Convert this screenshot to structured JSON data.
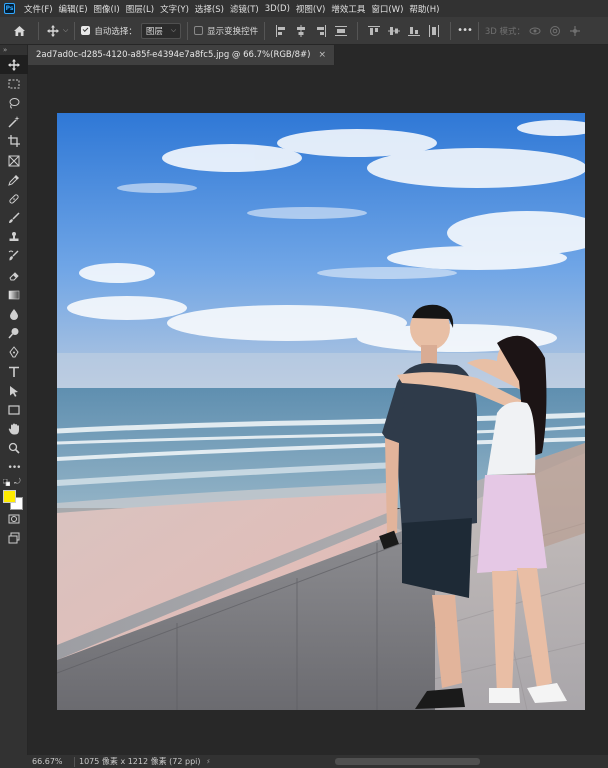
{
  "app": {
    "logo_text": "Ps",
    "menu": [
      "文件(F)",
      "编辑(E)",
      "图像(I)",
      "图层(L)",
      "文字(Y)",
      "选择(S)",
      "滤镜(T)",
      "3D(D)",
      "视图(V)",
      "增效工具",
      "窗口(W)",
      "帮助(H)"
    ]
  },
  "options_bar": {
    "auto_select_label": "自动选择：",
    "auto_select_checked": true,
    "auto_select_target": "图层",
    "show_transform_label": "显示变换控件",
    "show_transform_checked": false,
    "more_label": "•••",
    "mode_3d_label": "3D 模式："
  },
  "document": {
    "tab_title": "2ad7ad0c-d285-4120-a85f-e4394e7a8fc5.jpg @ 66.7%(RGB/8#)",
    "close_symbol": "×"
  },
  "toolbar": {
    "foreground_color": "#ffeb00",
    "background_color": "#ffffff",
    "tools": [
      "move-icon",
      "marquee-icon",
      "lasso-icon",
      "magic-wand-icon",
      "crop-icon",
      "frame-icon",
      "eyedropper-icon",
      "healing-brush-icon",
      "brush-icon",
      "clone-stamp-icon",
      "history-brush-icon",
      "eraser-icon",
      "gradient-icon",
      "blur-icon",
      "dodge-icon",
      "pen-icon",
      "type-icon",
      "path-selection-icon",
      "rectangle-icon",
      "hand-icon",
      "zoom-icon",
      "more-tools-icon"
    ],
    "extra_tools": [
      "quick-mask-icon",
      "screen-mode-icon"
    ]
  },
  "status": {
    "zoom": "66.67%",
    "doc_info": "1075 像素 x 1212 像素 (72 ppi)",
    "arrow": "›",
    "scroll_left": "‹"
  }
}
